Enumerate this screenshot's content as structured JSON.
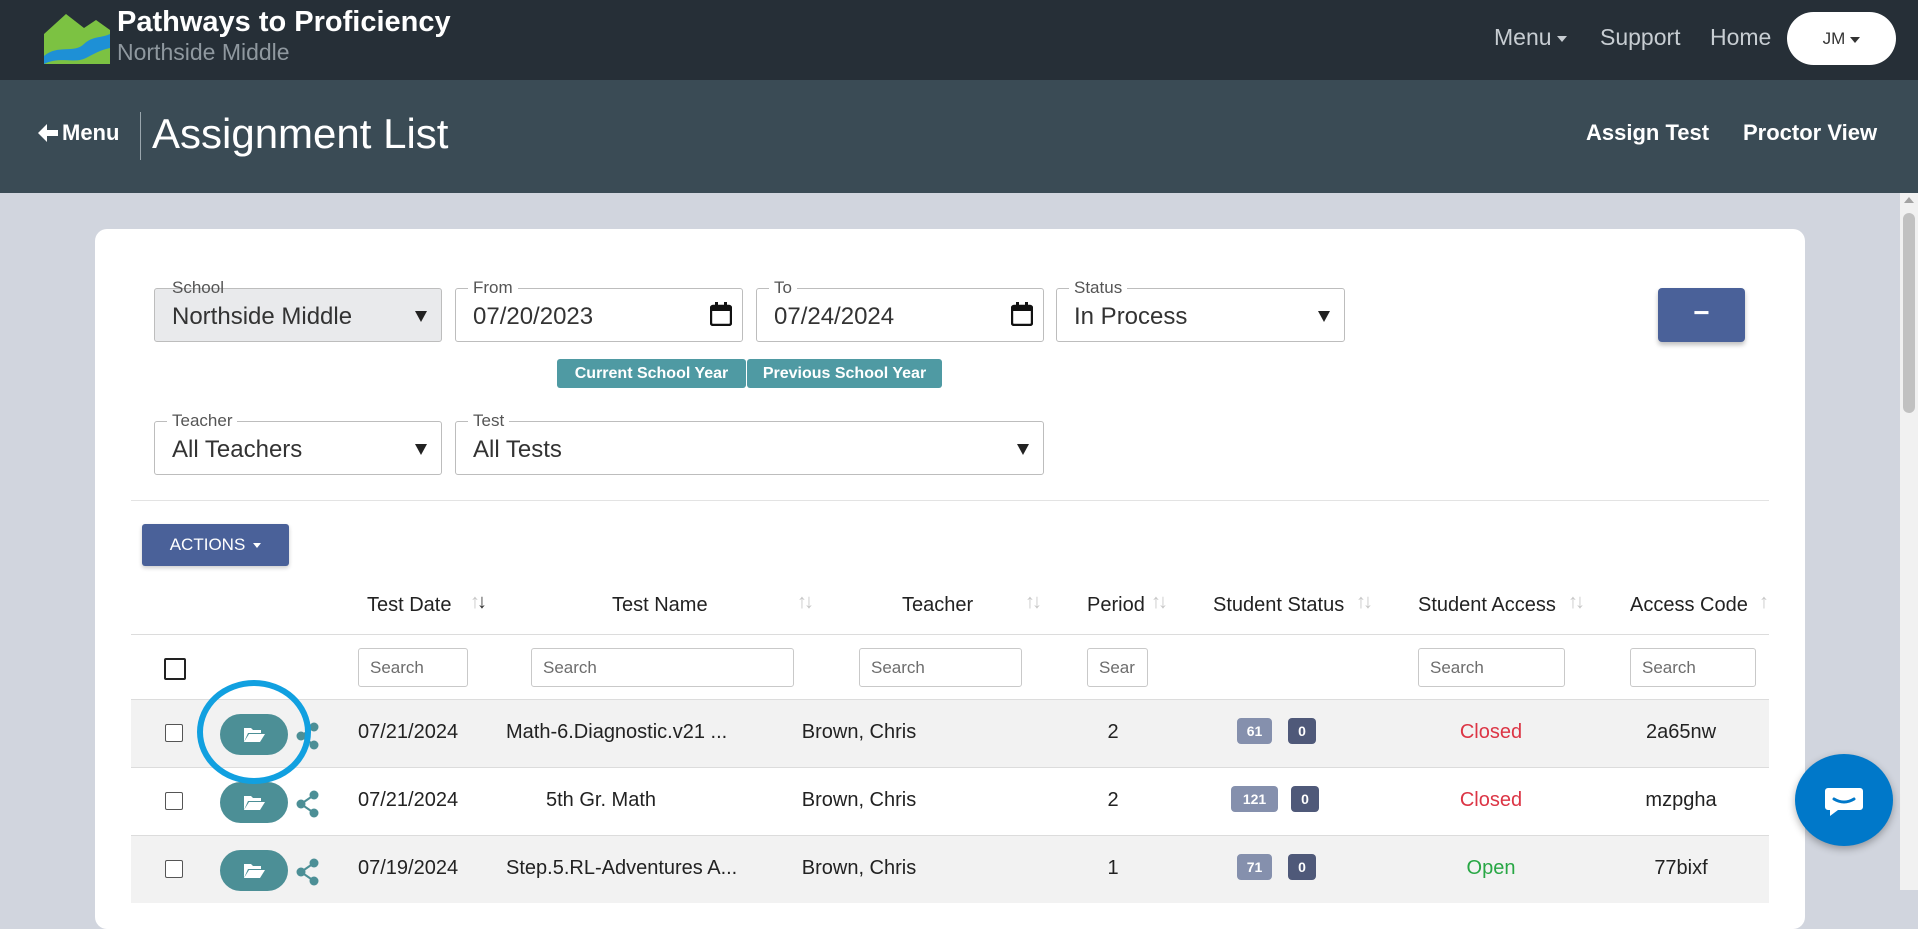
{
  "header": {
    "title": "Pathways to Proficiency",
    "subtitle": "Northside Middle",
    "nav": {
      "menu": "Menu",
      "support": "Support",
      "home": "Home"
    },
    "user_initials": "JM"
  },
  "subheader": {
    "back_label": "Menu",
    "page_title": "Assignment List",
    "assign_test": "Assign Test",
    "proctor_view": "Proctor View"
  },
  "filters": {
    "school": {
      "label": "School",
      "value": "Northside Middle"
    },
    "from": {
      "label": "From",
      "value": "07/20/2023"
    },
    "to": {
      "label": "To",
      "value": "07/24/2024"
    },
    "status": {
      "label": "Status",
      "value": "In Process"
    },
    "teacher": {
      "label": "Teacher",
      "value": "All Teachers"
    },
    "test": {
      "label": "Test",
      "value": "All Tests"
    },
    "quick_ranges": [
      "Current School Year",
      "Previous School Year"
    ],
    "collapse_symbol": "−"
  },
  "actions_label": "ACTIONS",
  "table": {
    "columns": [
      "Test Date",
      "Test Name",
      "Teacher",
      "Period",
      "Student Status",
      "Student Access",
      "Access Code"
    ],
    "search_placeholders": {
      "test_date": "Search",
      "test_name": "Search",
      "teacher": "Search",
      "period": "Sear",
      "student_access": "Search",
      "access_code": "Search"
    },
    "rows": [
      {
        "date": "07/21/2024",
        "name": "Math-6.Diagnostic.v21 ...",
        "teacher": "Brown, Chris",
        "period": "2",
        "count": "61",
        "flag": "0",
        "access": "Closed",
        "code": "2a65nw"
      },
      {
        "date": "07/21/2024",
        "name": "5th Gr. Math",
        "teacher": "Brown, Chris",
        "period": "2",
        "count": "121",
        "flag": "0",
        "access": "Closed",
        "code": "mzpgha"
      },
      {
        "date": "07/19/2024",
        "name": "Step.5.RL-Adventures A...",
        "teacher": "Brown, Chris",
        "period": "1",
        "count": "71",
        "flag": "0",
        "access": "Open",
        "code": "77bixf"
      }
    ]
  },
  "colors": {
    "topbar": "#262f37",
    "subheader": "#3a4b55",
    "primary": "#4a6199",
    "teal": "#4c8f96",
    "closed": "#dc3545",
    "open": "#28a745",
    "highlight": "#11a0e0"
  },
  "icons": [
    "folder-open-icon",
    "share-icon",
    "calendar-icon",
    "arrow-left-icon",
    "chat-icon"
  ]
}
